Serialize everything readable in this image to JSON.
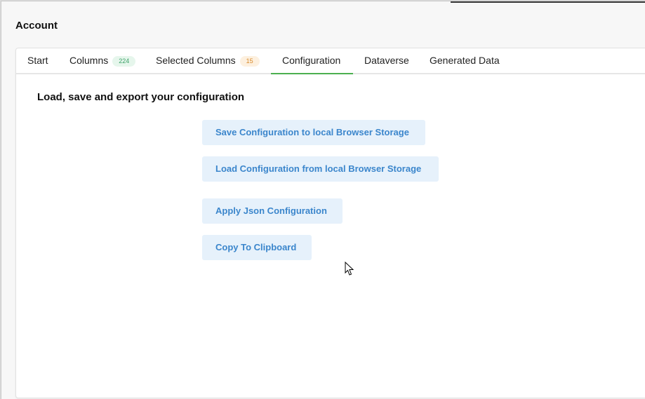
{
  "window": {
    "title": "Account"
  },
  "tabs": [
    {
      "label": "Start"
    },
    {
      "label": "Columns",
      "badge": "224"
    },
    {
      "label": "Selected Columns",
      "badge": "15"
    },
    {
      "label": "Configuration",
      "active": true
    },
    {
      "label": "Dataverse"
    },
    {
      "label": "Generated Data"
    }
  ],
  "config": {
    "heading": "Load, save and export your configuration",
    "buttons": {
      "save": "Save Configuration to local Browser Storage",
      "load": "Load Configuration from local Browser Storage",
      "apply": "Apply Json Configuration",
      "copy": "Copy To Clipboard"
    }
  },
  "colors": {
    "accent_green": "#4caf50",
    "button_bg": "#e6f1fb",
    "button_text": "#3b86cc"
  }
}
